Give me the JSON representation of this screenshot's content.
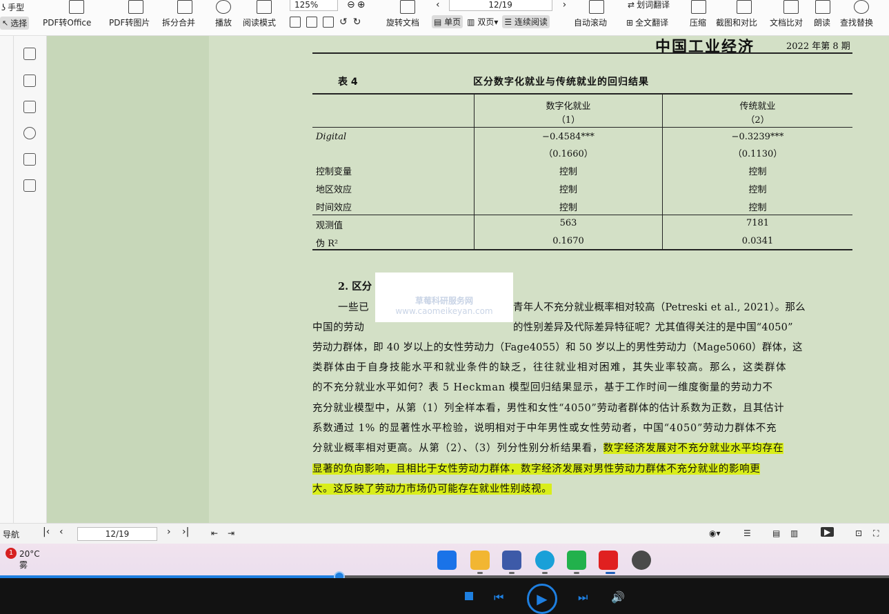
{
  "toolbar": {
    "hand_label": "手型",
    "select_label": "选择",
    "pdf_to_office": "PDF转Office",
    "pdf_to_image": "PDF转图片",
    "split_merge": "拆分合并",
    "play": "播放",
    "read_mode": "阅读模式",
    "zoom": "125%",
    "rotate": "旋转文档",
    "page_indicator": "12/19",
    "single_page": "单页",
    "double_page": "双页",
    "continuous": "连续阅读",
    "auto_scroll": "自动滚动",
    "translate": "划词翻译",
    "full_translate": "全文翻译",
    "compress": "压缩",
    "screenshot_compare": "截图和对比",
    "doc_compare": "文档比对",
    "read_aloud": "朗读",
    "find_replace": "查找替换"
  },
  "document": {
    "journal_name": "中国工业经济",
    "issue": "2022 年第 8 期",
    "table_number": "表 4",
    "table_title": "区分数字化就业与传统就业的回归结果",
    "columns": [
      {
        "name": "数字化就业",
        "index": "（1）"
      },
      {
        "name": "传统就业",
        "index": "（2）"
      }
    ],
    "rows": [
      {
        "label": "Digital",
        "v1": "−0.4584***",
        "v2": "−0.3239***"
      },
      {
        "label": "",
        "v1": "（0.1660）",
        "v2": "（0.1130）"
      },
      {
        "label": "控制变量",
        "v1": "控制",
        "v2": "控制"
      },
      {
        "label": "地区效应",
        "v1": "控制",
        "v2": "控制"
      },
      {
        "label": "时间效应",
        "v1": "控制",
        "v2": "控制"
      },
      {
        "label": "观测值",
        "v1": "563",
        "v2": "7181"
      },
      {
        "label": "伪 R²",
        "v1": "0.1670",
        "v2": "0.0341"
      }
    ],
    "section_heading": "2. 区分",
    "paragraph": [
      "一些已",
      "青年人不充分就业概率相对较高（Petreski et al., 2021）。那么",
      "中国的劳动",
      "的性别差异及代际差异特征呢？尤其值得关注的是中国“4050”",
      "劳动力群体，即 40 岁以上的女性劳动力（Fage4055）和 50 岁以上的男性劳动力（Mage5060）群体，这",
      "类群体由于自身技能水平和就业条件的缺乏，往往就业相对困难，其失业率较高。那么，这类群体",
      "的不充分就业水平如何？表 5 Heckman 模型回归结果显示，基于工作时间一维度衡量的劳动力不",
      "充分就业模型中，从第（1）列全样本看，男性和女性“4050”劳动者群体的估计系数为正数，且其估计",
      "系数通过 1% 的显著性水平检验，说明相对于中年男性或女性劳动者，中国“4050”劳动力群体不充",
      "分就业概率相对更高。从第（2）、（3）列分性别分析结果看，",
      "数字经济发展对不充分就业水平均存在",
      "显著的负向影响，且相比于女性劳动力群体，数字经济发展对男性劳动力群体不充分就业的影响更",
      "大。这反映了劳动力市场仍可能存在就业性别歧视。"
    ]
  },
  "watermark": {
    "line1": "草莓科研服务网",
    "line2": "www.caomeikeyan.com"
  },
  "statusbar": {
    "nav_label": "导航",
    "page_indicator": "12/19"
  },
  "taskbar": {
    "temperature": "20°C",
    "weather_text": "雾",
    "notification_count": "1"
  },
  "player": {
    "progress_fraction": 0.382
  },
  "colors": {
    "page_bg": "#d3e0c6",
    "highlight": "#d9ee1a",
    "progress": "#1e7fe0"
  }
}
